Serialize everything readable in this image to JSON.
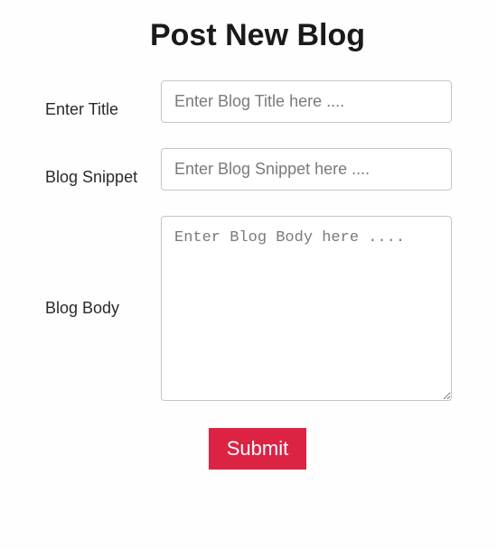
{
  "heading": "Post New Blog",
  "form": {
    "title": {
      "label": "Enter Title",
      "placeholder": "Enter Blog Title here ....",
      "value": ""
    },
    "snippet": {
      "label": "Blog Snippet",
      "placeholder": "Enter Blog Snippet here ....",
      "value": ""
    },
    "body": {
      "label": "Blog Body",
      "placeholder": "Enter Blog Body here ....",
      "value": ""
    },
    "submit_label": "Submit"
  },
  "colors": {
    "submit_bg": "#dc2344",
    "submit_text": "#ffffff"
  }
}
